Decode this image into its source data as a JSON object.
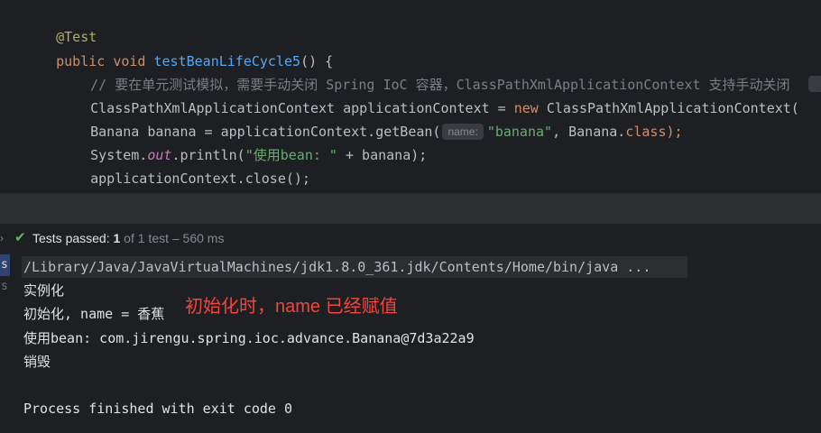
{
  "editor": {
    "annotation": "@Test",
    "sig_public": "public",
    "sig_void": "void",
    "sig_name": "testBeanLifeCycle5",
    "sig_rest": "() {",
    "comment": "// 要在单元测试模拟，需要手动关闭 Spring IoC 容器，ClassPathXmlApplicationContext 支持手动关闭",
    "line3_pre": "ClassPathXmlApplicationContext applicationContext = ",
    "line3_new": "new",
    "line3_post": " ClassPathXmlApplicationContext(",
    "line4_pre": "Banana banana = applicationContext.getBean(",
    "line4_hint": "name:",
    "line4_str": "\"banana\"",
    "line4_mid": ", Banana.",
    "line4_class": "class",
    "line4_end": ");",
    "line5_pre": "System.",
    "line5_out": "out",
    "line5_mid": ".println(",
    "line5_str": "\"使用bean: \"",
    "line5_end": " + banana);",
    "line6": "applicationContext.close();",
    "closing": "}"
  },
  "run": {
    "chevron": "›",
    "check": "✔",
    "label": "Tests passed: ",
    "passed": "1",
    "of_total": " of 1 test – 560 ms"
  },
  "gutter": {
    "g1": "s",
    "g2": "s"
  },
  "console": {
    "path": "/Library/Java/JavaVirtualMachines/jdk1.8.0_361.jdk/Contents/Home/bin/java ...",
    "line1": "实例化",
    "line2": "初始化, name = 香蕉",
    "line3": "使用bean: com.jirengu.spring.ioc.advance.Banana@7d3a22a9",
    "line4": "销毁",
    "line5": "Process finished with exit code 0"
  },
  "annotation_note": "初始化时，name 已经赋值"
}
